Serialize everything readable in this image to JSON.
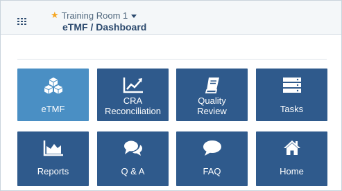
{
  "header": {
    "room_name": "Training Room 1",
    "breadcrumb": "eTMF / Dashboard",
    "star_color": "#f5a623"
  },
  "tiles": [
    {
      "label": "eTMF",
      "icon": "cubes-icon",
      "active": true
    },
    {
      "label": "CRA Reconciliation",
      "icon": "line-chart-icon",
      "active": false
    },
    {
      "label": "Quality Review",
      "icon": "book-icon",
      "active": false
    },
    {
      "label": "Tasks",
      "icon": "server-icon",
      "active": false
    },
    {
      "label": "Reports",
      "icon": "area-chart-icon",
      "active": false
    },
    {
      "label": "Q & A",
      "icon": "comments-icon",
      "active": false
    },
    {
      "label": "FAQ",
      "icon": "comment-icon",
      "active": false
    },
    {
      "label": "Home",
      "icon": "home-icon",
      "active": false
    }
  ],
  "colors": {
    "tile": "#2f5a8c",
    "tile_active": "#4a8fc4",
    "header_text": "#2c4a6e"
  }
}
